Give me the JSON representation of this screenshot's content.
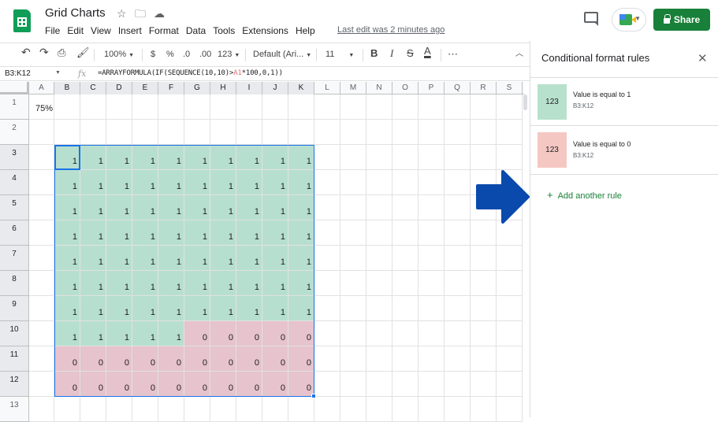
{
  "app": {
    "title": "Grid Charts",
    "menu": [
      "File",
      "Edit",
      "View",
      "Insert",
      "Format",
      "Data",
      "Tools",
      "Extensions",
      "Help"
    ],
    "last_edit": "Last edit was 2 minutes ago",
    "share_label": "Share"
  },
  "toolbar": {
    "zoom": "100%",
    "currency": "$",
    "percent": "%",
    "decrease_decimal": ".0",
    "increase_decimal": ".00",
    "more_formats": "123",
    "font": "Default (Ari...",
    "font_size": "11",
    "bold": "B",
    "italic": "I",
    "strike": "S",
    "text_color": "A",
    "more": "⋯"
  },
  "formula_bar": {
    "name_box": "B3:K12",
    "fx": "fx",
    "formula_prefix": "=ARRAYFORMULA(IF(SEQUENCE(10,10)>",
    "formula_ref": "A1",
    "formula_suffix": "*100,0,1))"
  },
  "sheet": {
    "columns": [
      "A",
      "B",
      "C",
      "D",
      "E",
      "F",
      "G",
      "H",
      "I",
      "J",
      "K",
      "L",
      "M",
      "N",
      "O",
      "P",
      "Q",
      "R",
      "S"
    ],
    "rows": [
      "1",
      "2",
      "3",
      "4",
      "5",
      "6",
      "7",
      "8",
      "9",
      "10",
      "11",
      "12",
      "13"
    ],
    "a1_value": "75%",
    "grid_values": [
      [
        "1",
        "1",
        "1",
        "1",
        "1",
        "1",
        "1",
        "1",
        "1",
        "1"
      ],
      [
        "1",
        "1",
        "1",
        "1",
        "1",
        "1",
        "1",
        "1",
        "1",
        "1"
      ],
      [
        "1",
        "1",
        "1",
        "1",
        "1",
        "1",
        "1",
        "1",
        "1",
        "1"
      ],
      [
        "1",
        "1",
        "1",
        "1",
        "1",
        "1",
        "1",
        "1",
        "1",
        "1"
      ],
      [
        "1",
        "1",
        "1",
        "1",
        "1",
        "1",
        "1",
        "1",
        "1",
        "1"
      ],
      [
        "1",
        "1",
        "1",
        "1",
        "1",
        "1",
        "1",
        "1",
        "1",
        "1"
      ],
      [
        "1",
        "1",
        "1",
        "1",
        "1",
        "1",
        "1",
        "1",
        "1",
        "1"
      ],
      [
        "1",
        "1",
        "1",
        "1",
        "1",
        "0",
        "0",
        "0",
        "0",
        "0"
      ],
      [
        "0",
        "0",
        "0",
        "0",
        "0",
        "0",
        "0",
        "0",
        "0",
        "0"
      ],
      [
        "0",
        "0",
        "0",
        "0",
        "0",
        "0",
        "0",
        "0",
        "0",
        "0"
      ]
    ],
    "colors": {
      "one": "#b7dfd0",
      "zero": "#e6c3cd",
      "selection": "#1a73e8"
    }
  },
  "panel": {
    "title": "Conditional format rules",
    "rules": [
      {
        "preview": "123",
        "condition": "Value is equal to 1",
        "range": "B3:K12",
        "color": "#b7e1cd"
      },
      {
        "preview": "123",
        "condition": "Value is equal to 0",
        "range": "B3:K12",
        "color": "#f4c7c3"
      }
    ],
    "add_rule": "Add another rule"
  }
}
